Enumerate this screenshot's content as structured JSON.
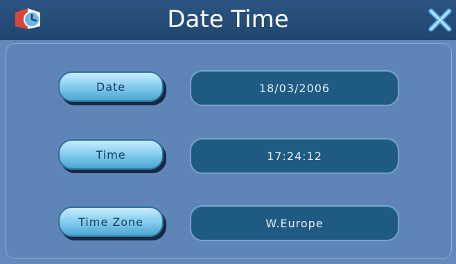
{
  "window": {
    "title": "Date Time",
    "app_icon": "clock-icon",
    "close_icon": "close-icon"
  },
  "rows": [
    {
      "button_label": "Date",
      "value": "18/03/2006"
    },
    {
      "button_label": "Time",
      "value": "17:24:12"
    },
    {
      "button_label": "Time Zone",
      "value": "W.Europe"
    }
  ],
  "colors": {
    "titlebar": "#1f4670",
    "panel": "#5f85b8",
    "button": "#8ad0f0",
    "field": "#1e5a82"
  }
}
